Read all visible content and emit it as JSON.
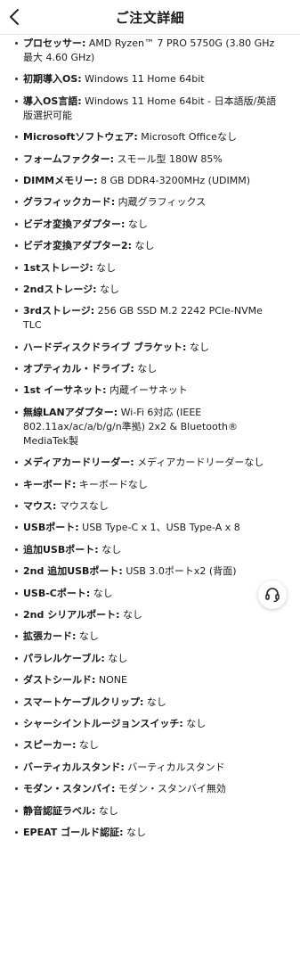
{
  "header": {
    "title": "ご注文詳細"
  },
  "specs": [
    {
      "label": "プロセッサー:",
      "value": " AMD Ryzen™ 7 PRO 5750G (3.80 GHz 最大 4.60 GHz)"
    },
    {
      "label": "初期導入OS:",
      "value": " Windows 11 Home 64bit"
    },
    {
      "label": "導入OS言語:",
      "value": " Windows 11 Home 64bit - 日本語版/英語版選択可能"
    },
    {
      "label": "Microsoftソフトウェア:",
      "value": " Microsoft Officeなし"
    },
    {
      "label": "フォームファクター:",
      "value": " スモール型 180W 85%"
    },
    {
      "label": "DIMMメモリー:",
      "value": " 8 GB DDR4-3200MHz (UDIMM)"
    },
    {
      "label": "グラフィックカード:",
      "value": " 内蔵グラフィックス"
    },
    {
      "label": "ビデオ変換アダプター:",
      "value": " なし"
    },
    {
      "label": "ビデオ変換アダプター2:",
      "value": " なし"
    },
    {
      "label": "1stストレージ:",
      "value": " なし"
    },
    {
      "label": "2ndストレージ:",
      "value": " なし"
    },
    {
      "label": "3rdストレージ:",
      "value": " 256 GB SSD M.2 2242 PCIe-NVMe TLC"
    },
    {
      "label": "ハードディスクドライブ ブラケット:",
      "value": " なし"
    },
    {
      "label": "オプティカル・ドライブ:",
      "value": " なし"
    },
    {
      "label": "1st イーサネット:",
      "value": " 内蔵イーサネット"
    },
    {
      "label": "無線LANアダプター:",
      "value": " Wi-Fi 6対応 (IEEE 802.11ax/ac/a/b/g/n準拠) 2x2 & Bluetooth® MediaTek製"
    },
    {
      "label": "メディアカードリーダー:",
      "value": " メディアカードリーダーなし"
    },
    {
      "label": "キーボード:",
      "value": " キーボードなし"
    },
    {
      "label": "マウス:",
      "value": " マウスなし"
    },
    {
      "label": "USBポート:",
      "value": " USB Type-C x 1、USB Type-A x 8"
    },
    {
      "label": "追加USBポート:",
      "value": " なし"
    },
    {
      "label": "2nd 追加USBポート:",
      "value": " USB 3.0ポートx2 (背面)"
    },
    {
      "label": "USB-Cポート:",
      "value": " なし"
    },
    {
      "label": "2nd シリアルポート:",
      "value": " なし"
    },
    {
      "label": "拡張カード:",
      "value": " なし"
    },
    {
      "label": "パラレルケーブル:",
      "value": " なし"
    },
    {
      "label": "ダストシールド:",
      "value": " NONE"
    },
    {
      "label": "スマートケーブルクリップ:",
      "value": " なし"
    },
    {
      "label": "シャーシイントルージョンスイッチ:",
      "value": " なし"
    },
    {
      "label": "スピーカー:",
      "value": " なし"
    },
    {
      "label": "バーティカルスタンド:",
      "value": " バーティカルスタンド"
    },
    {
      "label": "モダン・スタンバイ:",
      "value": " モダン・スタンバイ無効"
    },
    {
      "label": "静音認証ラベル:",
      "value": " なし"
    },
    {
      "label": "EPEAT ゴールド認証:",
      "value": " なし"
    }
  ],
  "icons": {
    "back": "chevron-left-icon",
    "support": "headset-icon"
  }
}
